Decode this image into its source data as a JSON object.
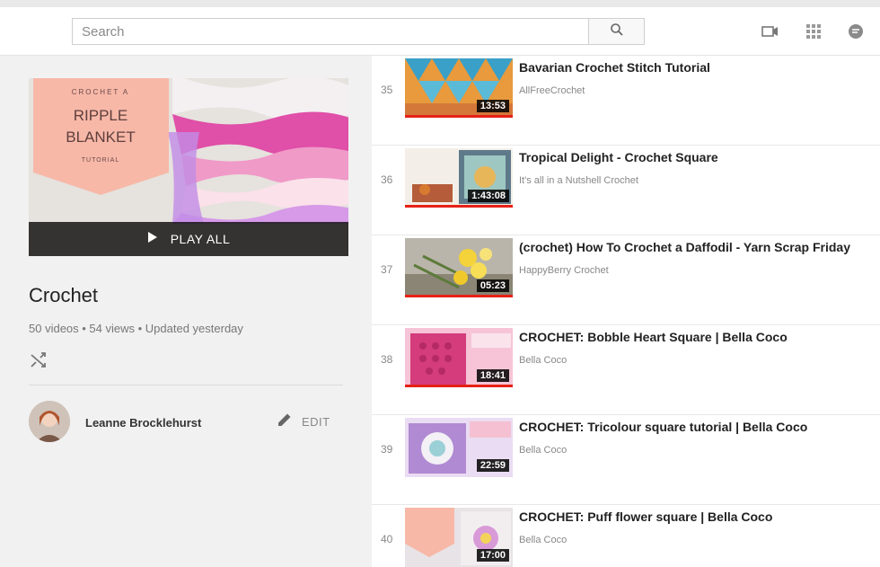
{
  "header": {
    "search_placeholder": "Search",
    "icons": [
      "search-icon",
      "upload-video-icon",
      "apps-grid-icon",
      "messages-icon"
    ]
  },
  "playlist": {
    "thumbnail_text": {
      "line1": "CROCHET A",
      "line2": "RIPPLE",
      "line3": "BLANKET",
      "line4": "TUTORIAL"
    },
    "play_all_label": "PLAY ALL",
    "title": "Crochet",
    "stats": "50 videos • 54 views • Updated yesterday",
    "owner_name": "Leanne Brocklehurst",
    "edit_label": "EDIT"
  },
  "videos": [
    {
      "index": "35",
      "title": "Bavarian Crochet Stitch Tutorial",
      "channel": "AllFreeCrochet",
      "duration": "13:53"
    },
    {
      "index": "36",
      "title": "Tropical Delight - Crochet Square",
      "channel": "It's all in a Nutshell Crochet",
      "duration": "1:43:08"
    },
    {
      "index": "37",
      "title": "(crochet) How To Crochet a Daffodil - Yarn Scrap Friday",
      "channel": "HappyBerry Crochet",
      "duration": "05:23"
    },
    {
      "index": "38",
      "title": "CROCHET: Bobble Heart Square | Bella Coco",
      "channel": "Bella Coco",
      "duration": "18:41"
    },
    {
      "index": "39",
      "title": "CROCHET: Tricolour square tutorial | Bella Coco",
      "channel": "Bella Coco",
      "duration": "22:59"
    },
    {
      "index": "40",
      "title": "CROCHET: Puff flower square | Bella Coco",
      "channel": "Bella Coco",
      "duration": "17:00"
    }
  ],
  "colors": {
    "accent_red": "#e62117",
    "thumb_pink": "#f7b8a8"
  }
}
